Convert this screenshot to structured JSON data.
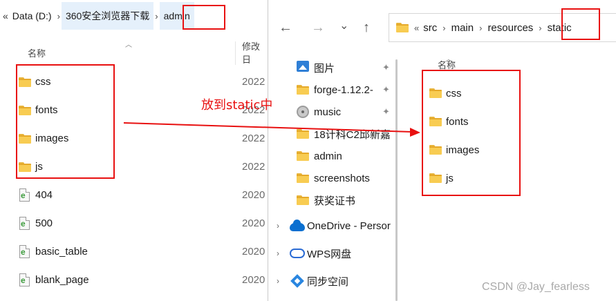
{
  "left_window": {
    "breadcrumb": {
      "back_chevron": "«",
      "parts": [
        "Data (D:)",
        "360安全浏览器下载",
        "admin"
      ],
      "separator": "›"
    },
    "columns": {
      "name": "名称",
      "modified": "修改日"
    },
    "files": [
      {
        "name": "css",
        "type": "folder",
        "date": "2022"
      },
      {
        "name": "fonts",
        "type": "folder",
        "date": "2022"
      },
      {
        "name": "images",
        "type": "folder",
        "date": "2022"
      },
      {
        "name": "js",
        "type": "folder",
        "date": "2022"
      },
      {
        "name": "404",
        "type": "html",
        "date": "2020"
      },
      {
        "name": "500",
        "type": "html",
        "date": "2020"
      },
      {
        "name": "basic_table",
        "type": "html",
        "date": "2020"
      },
      {
        "name": "blank_page",
        "type": "html",
        "date": "2020"
      }
    ]
  },
  "annotation": {
    "label": "放到static中",
    "color": "#e81010"
  },
  "right_window": {
    "nav_buttons": {
      "back": "←",
      "forward": "→",
      "history": "⌄",
      "up": "↑"
    },
    "address": {
      "overflow": "«",
      "parts": [
        "src",
        "main",
        "resources",
        "static"
      ],
      "separator": "›"
    },
    "nav_pane": [
      {
        "label": "图片",
        "icon": "pictures-icon",
        "pinned": true
      },
      {
        "label": "forge-1.12.2-",
        "icon": "folder-icon",
        "pinned": true
      },
      {
        "label": "music",
        "icon": "music-icon",
        "pinned": true
      },
      {
        "label": "18计科C2邱新嘉",
        "icon": "folder-icon",
        "pinned": false
      },
      {
        "label": "admin",
        "icon": "folder-icon",
        "pinned": false
      },
      {
        "label": "screenshots",
        "icon": "folder-icon",
        "pinned": false
      },
      {
        "label": "获奖证书",
        "icon": "folder-icon",
        "pinned": false
      },
      {
        "label": "OneDrive - Persor",
        "icon": "onedrive-icon",
        "expandable": true
      },
      {
        "label": "WPS网盘",
        "icon": "wps-icon",
        "expandable": true
      },
      {
        "label": "同步空间",
        "icon": "sync-icon",
        "expandable": true
      }
    ],
    "pin_glyph": "📌",
    "expander_glyph": "›",
    "column_name": "名称",
    "files": [
      {
        "name": "css",
        "type": "folder"
      },
      {
        "name": "fonts",
        "type": "folder"
      },
      {
        "name": "images",
        "type": "folder"
      },
      {
        "name": "js",
        "type": "folder"
      }
    ]
  },
  "watermark": "CSDN @Jay_fearless"
}
